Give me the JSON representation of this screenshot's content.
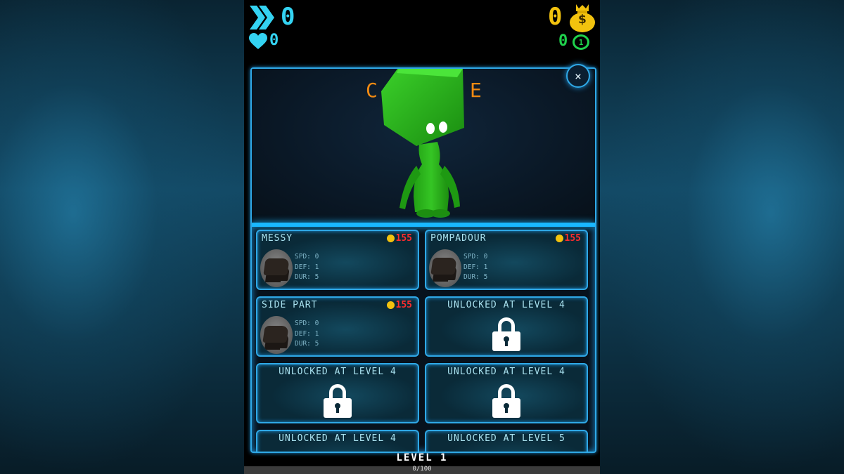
{
  "hud": {
    "speed_value": "0",
    "lives_value": "0",
    "coins_value": "0",
    "tokens_value": "0",
    "token_symbol": "1",
    "coin_symbol": "$",
    "icons": [
      "double-chevron-icon",
      "heart-icon",
      "money-bag-icon",
      "laurel-token-icon"
    ]
  },
  "preview": {
    "title_left": "C",
    "title_right": "E",
    "close_label": "×"
  },
  "items": [
    {
      "name": "MESSY",
      "price": "155",
      "stats": [
        "SPD: 0",
        "DEF: 1",
        "DUR: 5"
      ]
    },
    {
      "name": "POMPADOUR",
      "price": "155",
      "stats": [
        "SPD: 0",
        "DEF: 1",
        "DUR: 5"
      ]
    },
    {
      "name": "SIDE PART",
      "price": "155",
      "stats": [
        "SPD: 0",
        "DEF: 1",
        "DUR: 5"
      ]
    },
    {
      "locked": "UNLOCKED AT LEVEL 4"
    },
    {
      "locked": "UNLOCKED AT LEVEL 4"
    },
    {
      "locked": "UNLOCKED AT LEVEL 4"
    },
    {
      "locked": "UNLOCKED AT LEVEL 4"
    },
    {
      "locked": "UNLOCKED AT LEVEL 5"
    }
  ],
  "level": {
    "label": "LEVEL 1",
    "xp_text": "0/100",
    "xp_progress": 0.0
  },
  "colors": {
    "accent_cyan": "#34d3f2",
    "coin_yellow": "#f2c20e",
    "token_green": "#1fd24c",
    "price_red": "#ff2d2d",
    "frame_blue": "#2fa8e6",
    "character_green": "#2eb81c"
  }
}
